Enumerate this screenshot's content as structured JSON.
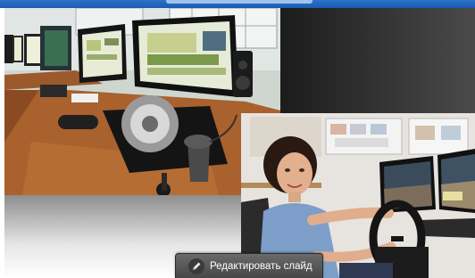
{
  "slideshow": {
    "edit_button_label": "Редактировать слайд",
    "edit_icon": "pencil-icon"
  },
  "colors": {
    "top_strip": "#1f63bb",
    "panel_dark": "#151515",
    "button_bg": "#585858"
  }
}
